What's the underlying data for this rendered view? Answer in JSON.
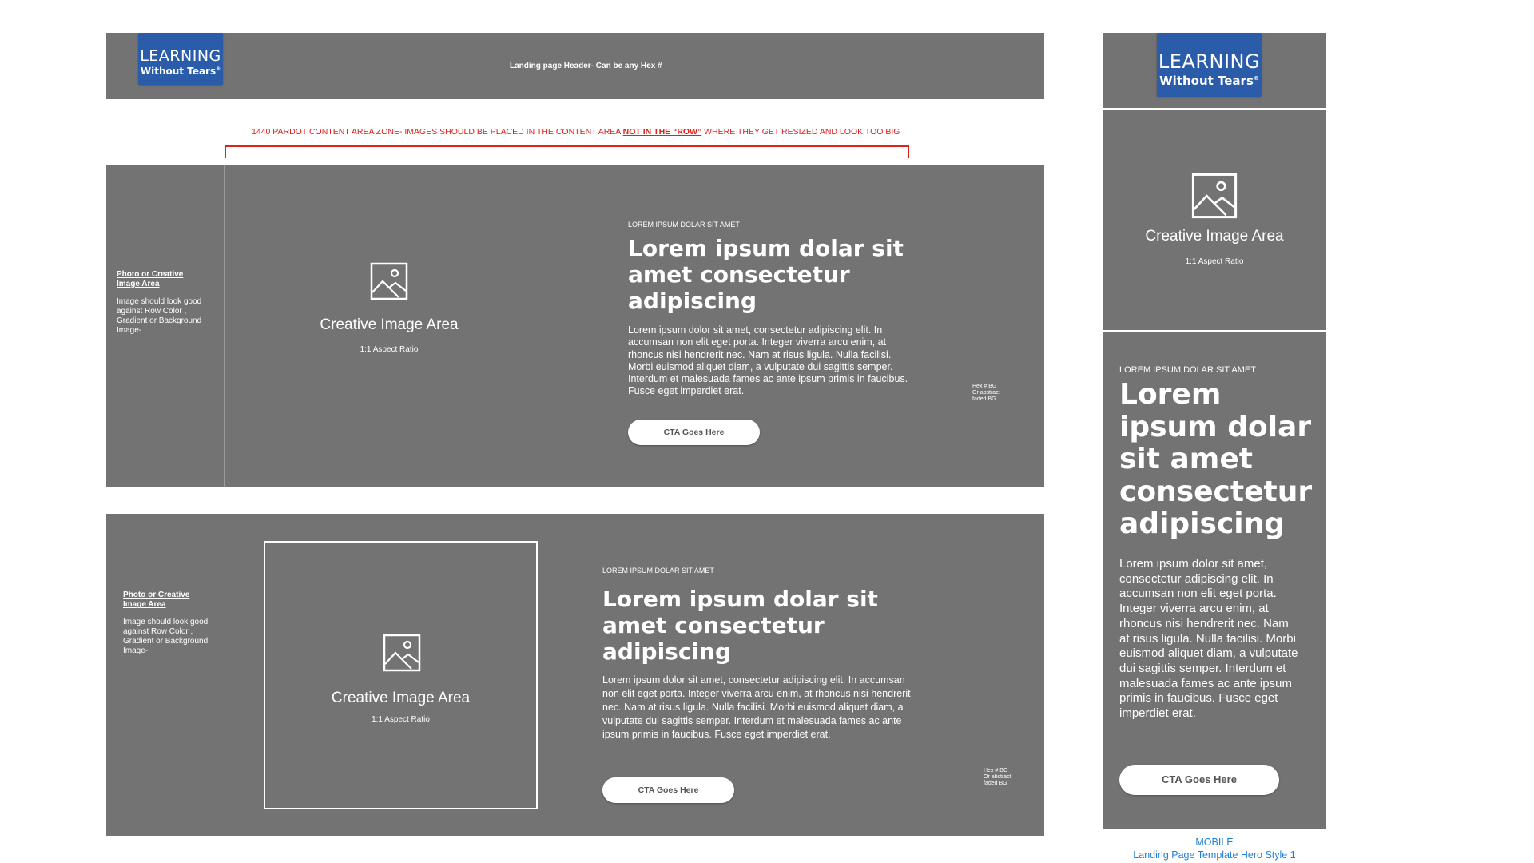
{
  "header": {
    "logo_line1": "LEARNING",
    "logo_line2": "Without Tears",
    "logo_sup": "®",
    "label": "Landing page Header- Can be any Hex #"
  },
  "zone_note": {
    "part1": "1440 PARDOT CONTENT AREA ZONE- IMAGES SHOULD BE PLACED IN THE CONTENT AREA ",
    "emphasis": "NOT IN THE “ROW”",
    "part2": " WHERE THEY GET RESIZED AND LOOK TOO BIG"
  },
  "hero1": {
    "side_title_line1": "Photo or Creative",
    "side_title_line2": "Image Area",
    "side_desc": "Image should look good against Row Color , Gradient or Background Image-",
    "image_title": "Creative Image Area",
    "image_ratio": "1:1 Aspect Ratio",
    "eyebrow": "LOREM IPSUM DOLAR SIT AMET",
    "heading": "Lorem ipsum dolar sit amet consectetur adipiscing",
    "body": "Lorem ipsum dolor sit amet, consectetur adipiscing elit. In accumsan non elit eget porta. Integer viverra arcu enim, at rhoncus nisi hendrerit nec. Nam at risus ligula. Nulla facilisi. Morbi euismod aliquet diam, a vulputate dui sagittis semper. Interdum et malesuada fames ac ante ipsum primis in faucibus. Fusce eget imperdiet erat.",
    "cta": "CTA Goes Here",
    "hex_note_line1": "Hex # BG",
    "hex_note_line2": "Or abstract",
    "hex_note_line3": "faded BG"
  },
  "hero2": {
    "side_title_line1": "Photo or Creative",
    "side_title_line2": "Image Area",
    "side_desc": "Image should look good against Row Color , Gradient or Background Image-",
    "image_title": "Creative Image Area",
    "image_ratio": "1:1 Aspect Ratio",
    "eyebrow": "LOREM IPSUM DOLAR SIT AMET",
    "heading": "Lorem ipsum dolar sit amet consectetur adipiscing",
    "body": "Lorem ipsum dolor sit amet, consectetur adipiscing elit. In accumsan non elit eget porta. Integer viverra arcu enim, at rhoncus nisi hendrerit nec. Nam at risus ligula. Nulla facilisi. Morbi euismod aliquet diam, a vulputate dui sagittis semper. Interdum et malesuada fames ac ante ipsum primis in faucibus. Fusce eget imperdiet erat.",
    "cta": "CTA Goes Here",
    "hex_note_line1": "Hex # BG",
    "hex_note_line2": "Or abstract",
    "hex_note_line3": "faded BG"
  },
  "mobile": {
    "logo_line1": "LEARNING",
    "logo_line2": "Without Tears",
    "logo_sup": "®",
    "image_title": "Creative Image Area",
    "image_ratio": "1:1 Aspect Ratio",
    "eyebrow": "LOREM IPSUM DOLAR SIT AMET",
    "heading": "Lorem ipsum dolar sit amet consectetur adipiscing",
    "body": "Lorem ipsum dolor sit amet, consectetur adipiscing elit. In accumsan non elit eget porta. Integer viverra arcu enim, at rhoncus nisi hendrerit nec. Nam at risus ligula. Nulla facilisi. Morbi euismod aliquet diam, a vulputate dui sagittis semper. Interdum et malesuada fames ac ante ipsum primis in faucibus. Fusce eget imperdiet erat.",
    "cta": "CTA Goes Here",
    "caption_line1": "MOBILE",
    "caption_line2": "Landing Page Template Hero Style 1"
  },
  "colors": {
    "panel_gray": "#737373",
    "logo_blue": "#2a5caa",
    "note_red": "#e0201b",
    "caption_blue": "#1f7fd6"
  }
}
